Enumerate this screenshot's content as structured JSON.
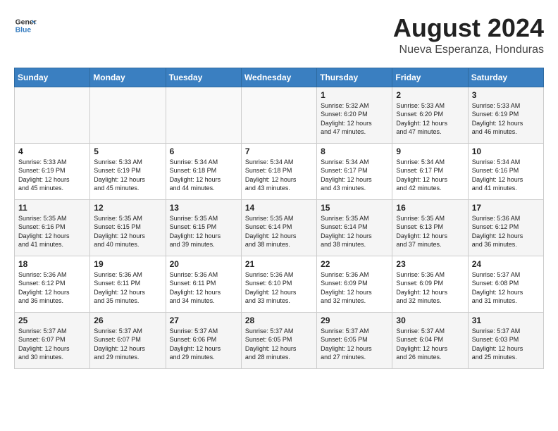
{
  "header": {
    "logo_line1": "General",
    "logo_line2": "Blue",
    "month_year": "August 2024",
    "location": "Nueva Esperanza, Honduras"
  },
  "weekdays": [
    "Sunday",
    "Monday",
    "Tuesday",
    "Wednesday",
    "Thursday",
    "Friday",
    "Saturday"
  ],
  "weeks": [
    [
      {
        "day": "",
        "info": ""
      },
      {
        "day": "",
        "info": ""
      },
      {
        "day": "",
        "info": ""
      },
      {
        "day": "",
        "info": ""
      },
      {
        "day": "1",
        "info": "Sunrise: 5:32 AM\nSunset: 6:20 PM\nDaylight: 12 hours\nand 47 minutes."
      },
      {
        "day": "2",
        "info": "Sunrise: 5:33 AM\nSunset: 6:20 PM\nDaylight: 12 hours\nand 47 minutes."
      },
      {
        "day": "3",
        "info": "Sunrise: 5:33 AM\nSunset: 6:19 PM\nDaylight: 12 hours\nand 46 minutes."
      }
    ],
    [
      {
        "day": "4",
        "info": "Sunrise: 5:33 AM\nSunset: 6:19 PM\nDaylight: 12 hours\nand 45 minutes."
      },
      {
        "day": "5",
        "info": "Sunrise: 5:33 AM\nSunset: 6:19 PM\nDaylight: 12 hours\nand 45 minutes."
      },
      {
        "day": "6",
        "info": "Sunrise: 5:34 AM\nSunset: 6:18 PM\nDaylight: 12 hours\nand 44 minutes."
      },
      {
        "day": "7",
        "info": "Sunrise: 5:34 AM\nSunset: 6:18 PM\nDaylight: 12 hours\nand 43 minutes."
      },
      {
        "day": "8",
        "info": "Sunrise: 5:34 AM\nSunset: 6:17 PM\nDaylight: 12 hours\nand 43 minutes."
      },
      {
        "day": "9",
        "info": "Sunrise: 5:34 AM\nSunset: 6:17 PM\nDaylight: 12 hours\nand 42 minutes."
      },
      {
        "day": "10",
        "info": "Sunrise: 5:34 AM\nSunset: 6:16 PM\nDaylight: 12 hours\nand 41 minutes."
      }
    ],
    [
      {
        "day": "11",
        "info": "Sunrise: 5:35 AM\nSunset: 6:16 PM\nDaylight: 12 hours\nand 41 minutes."
      },
      {
        "day": "12",
        "info": "Sunrise: 5:35 AM\nSunset: 6:15 PM\nDaylight: 12 hours\nand 40 minutes."
      },
      {
        "day": "13",
        "info": "Sunrise: 5:35 AM\nSunset: 6:15 PM\nDaylight: 12 hours\nand 39 minutes."
      },
      {
        "day": "14",
        "info": "Sunrise: 5:35 AM\nSunset: 6:14 PM\nDaylight: 12 hours\nand 38 minutes."
      },
      {
        "day": "15",
        "info": "Sunrise: 5:35 AM\nSunset: 6:14 PM\nDaylight: 12 hours\nand 38 minutes."
      },
      {
        "day": "16",
        "info": "Sunrise: 5:35 AM\nSunset: 6:13 PM\nDaylight: 12 hours\nand 37 minutes."
      },
      {
        "day": "17",
        "info": "Sunrise: 5:36 AM\nSunset: 6:12 PM\nDaylight: 12 hours\nand 36 minutes."
      }
    ],
    [
      {
        "day": "18",
        "info": "Sunrise: 5:36 AM\nSunset: 6:12 PM\nDaylight: 12 hours\nand 36 minutes."
      },
      {
        "day": "19",
        "info": "Sunrise: 5:36 AM\nSunset: 6:11 PM\nDaylight: 12 hours\nand 35 minutes."
      },
      {
        "day": "20",
        "info": "Sunrise: 5:36 AM\nSunset: 6:11 PM\nDaylight: 12 hours\nand 34 minutes."
      },
      {
        "day": "21",
        "info": "Sunrise: 5:36 AM\nSunset: 6:10 PM\nDaylight: 12 hours\nand 33 minutes."
      },
      {
        "day": "22",
        "info": "Sunrise: 5:36 AM\nSunset: 6:09 PM\nDaylight: 12 hours\nand 32 minutes."
      },
      {
        "day": "23",
        "info": "Sunrise: 5:36 AM\nSunset: 6:09 PM\nDaylight: 12 hours\nand 32 minutes."
      },
      {
        "day": "24",
        "info": "Sunrise: 5:37 AM\nSunset: 6:08 PM\nDaylight: 12 hours\nand 31 minutes."
      }
    ],
    [
      {
        "day": "25",
        "info": "Sunrise: 5:37 AM\nSunset: 6:07 PM\nDaylight: 12 hours\nand 30 minutes."
      },
      {
        "day": "26",
        "info": "Sunrise: 5:37 AM\nSunset: 6:07 PM\nDaylight: 12 hours\nand 29 minutes."
      },
      {
        "day": "27",
        "info": "Sunrise: 5:37 AM\nSunset: 6:06 PM\nDaylight: 12 hours\nand 29 minutes."
      },
      {
        "day": "28",
        "info": "Sunrise: 5:37 AM\nSunset: 6:05 PM\nDaylight: 12 hours\nand 28 minutes."
      },
      {
        "day": "29",
        "info": "Sunrise: 5:37 AM\nSunset: 6:05 PM\nDaylight: 12 hours\nand 27 minutes."
      },
      {
        "day": "30",
        "info": "Sunrise: 5:37 AM\nSunset: 6:04 PM\nDaylight: 12 hours\nand 26 minutes."
      },
      {
        "day": "31",
        "info": "Sunrise: 5:37 AM\nSunset: 6:03 PM\nDaylight: 12 hours\nand 25 minutes."
      }
    ]
  ]
}
